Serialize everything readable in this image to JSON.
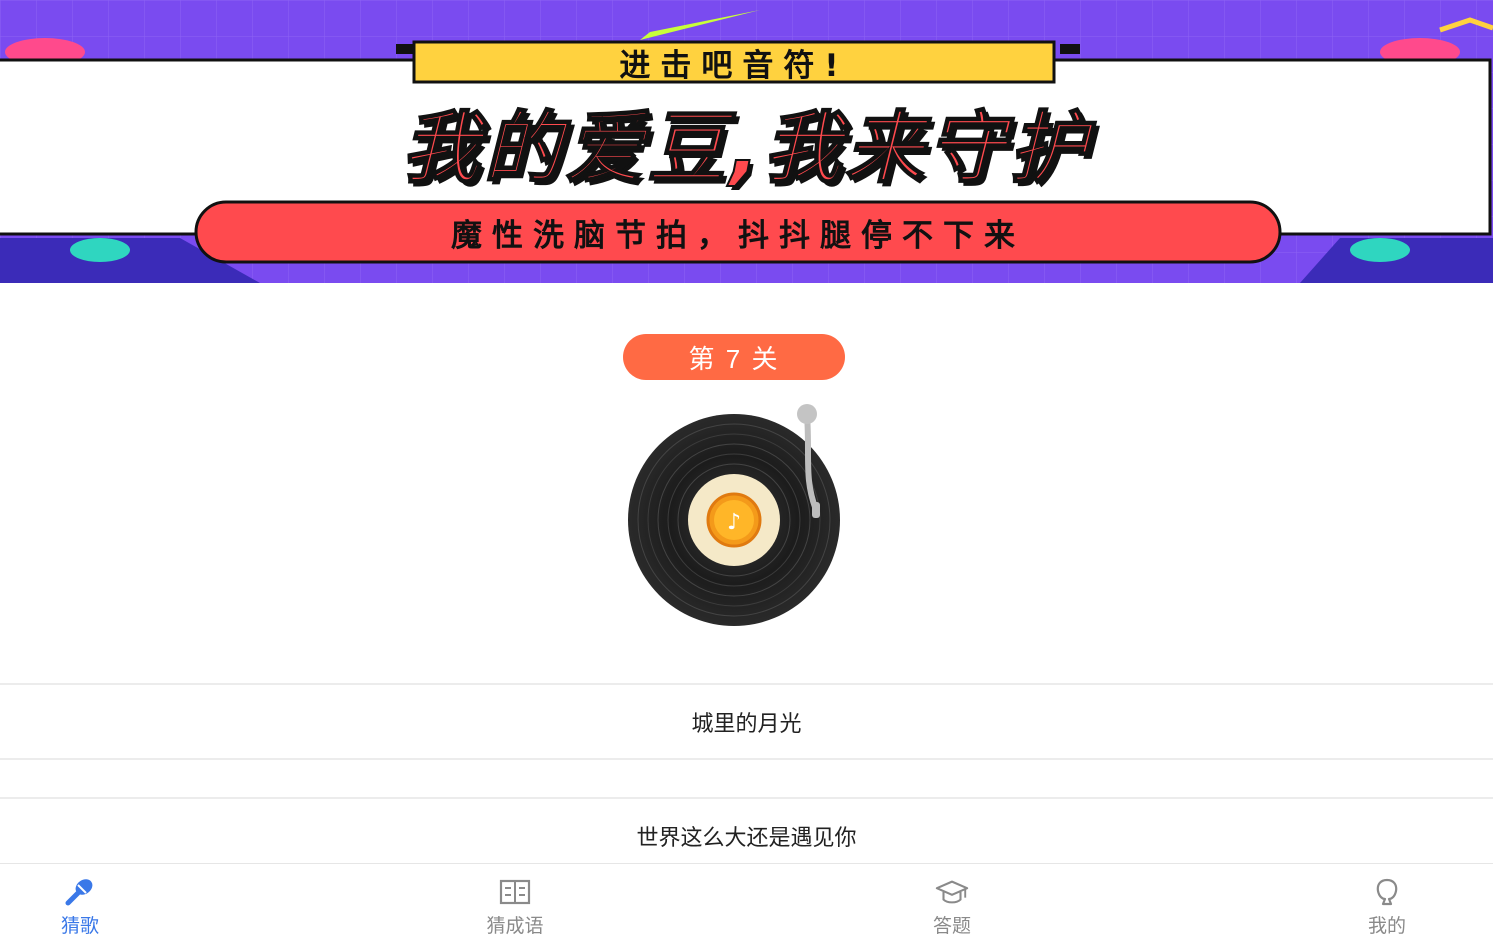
{
  "banner": {
    "top_text": "进击吧音符!",
    "title": "我的爱豆,我来守护",
    "subtitle": "魔性洗脑节拍，抖抖腿停不下来"
  },
  "level": {
    "label": "第 7 关"
  },
  "options": [
    {
      "text": "城里的月光"
    },
    {
      "text": ""
    },
    {
      "text": "世界这么大还是遇见你"
    }
  ],
  "tabs": [
    {
      "label": "猜歌",
      "icon": "microphone-icon",
      "active": true
    },
    {
      "label": "猜成语",
      "icon": "book-icon",
      "active": false
    },
    {
      "label": "答题",
      "icon": "graduation-cap-icon",
      "active": false
    },
    {
      "label": "我的",
      "icon": "person-icon",
      "active": false
    }
  ],
  "colors": {
    "banner_bg": "#7a4bf0",
    "banner_red": "#ff4a4e",
    "badge": "#ff6a44",
    "active_tab": "#3a78e8",
    "inactive_tab": "#8a8a8a"
  }
}
